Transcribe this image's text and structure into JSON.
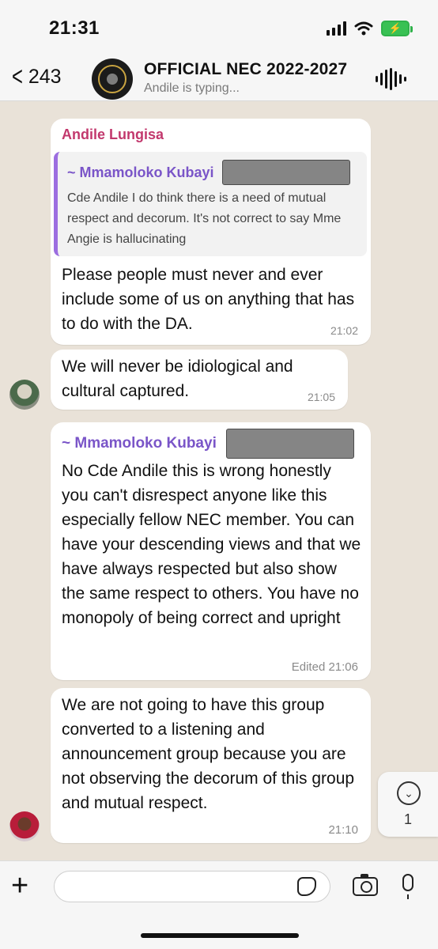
{
  "status_bar": {
    "time": "21:31"
  },
  "header": {
    "back_count": "243",
    "title": "OFFICIAL NEC 2022-2027",
    "subtitle": "Andile is typing..."
  },
  "messages": [
    {
      "sender": "Andile Lungisa",
      "quote_author": "~ Mmamoloko Kubayi",
      "quote_text": "Cde Andile I do think there is a need of mutual respect and decorum. It's not correct to say Mme Angie is hallucinating",
      "text": "Please people must never and ever include some of us on anything that has to do with the DA.",
      "time": "21:02"
    },
    {
      "text": "We will never be idiological and cultural captured.",
      "time": "21:05"
    },
    {
      "author": "~ Mmamoloko Kubayi",
      "text": "No Cde Andile this is wrong honestly you can't disrespect anyone like this especially fellow NEC member. You can have your descending views and that we have always respected but also show the same respect to others. You have no monopoly of being correct and upright",
      "time": "Edited 21:06"
    },
    {
      "text": "We are not going to have this group converted to a listening and announcement group because you are not observing the decorum of this group and mutual respect.",
      "time": "21:10"
    }
  ],
  "scroll_button": {
    "count": "1"
  },
  "input": {
    "placeholder": ""
  }
}
